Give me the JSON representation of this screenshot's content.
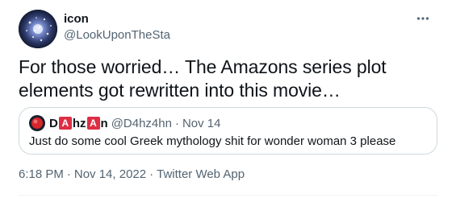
{
  "author": {
    "name": "icon",
    "handle": "@LookUponTheSta"
  },
  "tweet": {
    "text": "For those worried… The Amazons series plot elements got rewritten into this movie…"
  },
  "quoted_tweet": {
    "name_parts": [
      "D",
      "A",
      "hz",
      "A",
      "n"
    ],
    "handle": "@D4hz4hn",
    "separator": "·",
    "date": "Nov 14",
    "text": "Just do some cool Greek mythology shit for wonder woman 3 please"
  },
  "meta": {
    "time": "6:18 PM",
    "separator": "·",
    "date": "Nov 14, 2022",
    "source": "Twitter Web App"
  },
  "icons": {
    "avatar": "starfield-avatar",
    "more": "more-horizontal-icon",
    "quoted_avatar": "red-circle-avatar"
  },
  "colors": {
    "text": "#0f1419",
    "muted": "#536471",
    "border": "#cfd9de",
    "emoji_red": "#dd2e44"
  }
}
